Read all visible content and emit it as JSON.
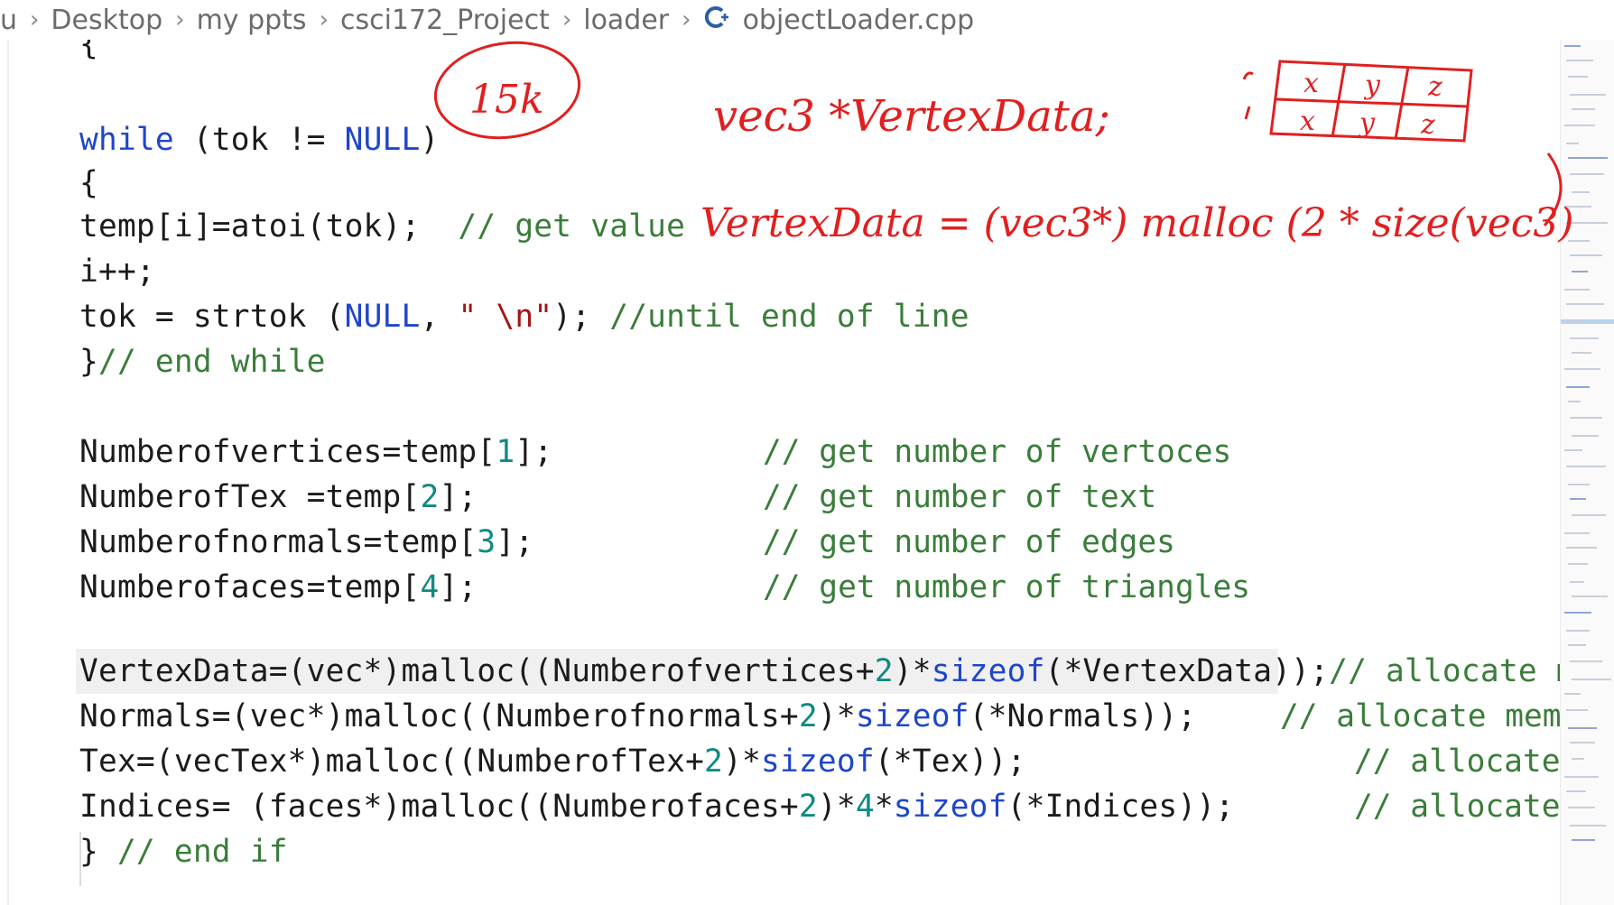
{
  "breadcrumb": {
    "items": [
      "u",
      "Desktop",
      "my ppts",
      "csci172_Project",
      "loader"
    ],
    "file_icon": "cpp-file-icon",
    "file_name": "objectLoader.cpp"
  },
  "colors": {
    "keyword": "#1f46c8",
    "number": "#108a81",
    "comment": "#3a7d3a",
    "ink": "#e02020"
  },
  "code": {
    "brace_open": "{",
    "l_while_kw": "while",
    "l_while_rest_a": " (tok != ",
    "l_while_null": "NULL",
    "l_while_rest_b": ")",
    "l_temp_code": "temp[i]=atoi(tok);  ",
    "l_temp_comment": "// get value",
    "l_inc": "i++;",
    "l_tok_a": "tok = strtok (",
    "l_tok_null": "NULL",
    "l_tok_b": ", ",
    "l_tok_str": "\" \\n\"",
    "l_tok_c": "); ",
    "l_tok_comment": "//until end of line",
    "l_end_brace": "}",
    "l_end_comment": "// end while",
    "l_nv_a": "Numberofvertices=temp[",
    "l_nv_n": "1",
    "l_nv_b": "];",
    "l_nt_a": "NumberofTex =temp[",
    "l_nt_n": "2",
    "l_nt_b": "];",
    "l_nn_a": "Numberofnormals=temp[",
    "l_nn_n": "3",
    "l_nn_b": "];",
    "l_nf_a": "Numberofaces=temp[",
    "l_nf_n": "4",
    "l_nf_b": "];",
    "c_vertices": "// get number of vertoces",
    "c_tex": "// get number of text",
    "c_edges": "// get number of edges",
    "c_triangles": "// get number of triangles",
    "l_vd_a": "VertexData=(vec*)malloc((Numberofvertices+",
    "l_vd_n": "2",
    "l_vd_b": ")*",
    "l_vd_kw": "sizeof",
    "l_vd_c": "(*VertexData));",
    "l_vd_comment": "// allocate me",
    "l_no_a": "Normals=(vec*)malloc((Numberofnormals+",
    "l_no_n": "2",
    "l_no_b": ")*",
    "l_no_kw": "sizeof",
    "l_no_c": "(*Normals));",
    "l_no_comment": "// allocate mem",
    "l_tx_a": "Tex=(vecTex*)malloc((NumberofTex+",
    "l_tx_n": "2",
    "l_tx_b": ")*",
    "l_tx_kw": "sizeof",
    "l_tx_c": "(*Tex));",
    "l_tx_comment": "// allocate",
    "l_in_a": "Indices= (faces*)malloc((Numberofaces+",
    "l_in_n": "2",
    "l_in_b": ")*",
    "l_in_n2": "4",
    "l_in_c": "*",
    "l_in_kw": "sizeof",
    "l_in_d": "(*Indices));",
    "l_in_comment": "// allocate",
    "l_endif_brace": "} ",
    "l_endif_comment": "// end if"
  },
  "annotations": {
    "circled": "15k",
    "decl": "vec3 *VertexData;",
    "alloc": "VertexData = (vec3*) malloc (2 * size(vec3)",
    "grid_row1": [
      "x",
      "y",
      "z"
    ],
    "grid_row2": [
      "x",
      "y",
      "z"
    ]
  }
}
